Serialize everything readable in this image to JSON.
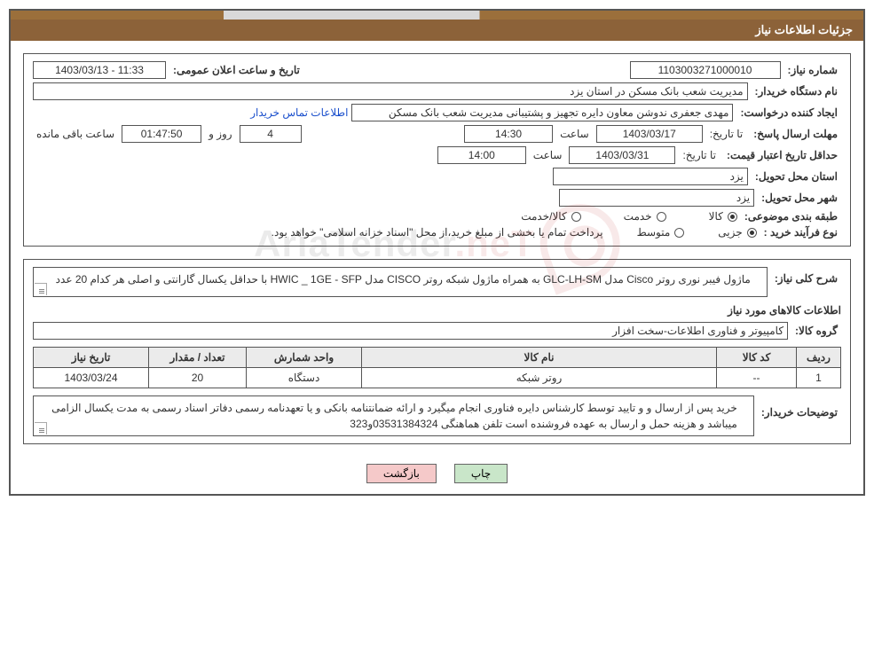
{
  "title": "جزئیات اطلاعات نیاز",
  "top": {
    "need_no_label": "شماره نیاز:",
    "need_no": "1103003271000010",
    "announce_label": "تاریخ و ساعت اعلان عمومی:",
    "announce_dt": "11:33 - 1403/03/13",
    "buyer_org_label": "نام دستگاه خریدار:",
    "buyer_org": "مدیریت شعب بانک مسکن در استان یزد",
    "creator_label": "ایجاد کننده درخواست:",
    "creator": "مهدی  جعفری ندوشن معاون دایره تجهیز و پشتیبانی مدیریت شعب بانک مسکن",
    "contact_link": "اطلاعات تماس خریدار",
    "deadline_label": "مهلت ارسال پاسخ:",
    "until_date_label": "تا تاریخ:",
    "deadline_date": "1403/03/17",
    "hour_label": "ساعت",
    "deadline_time": "14:30",
    "days_label": "روز و",
    "days_left": "4",
    "countdown": "01:47:50",
    "remain_label": "ساعت باقی مانده",
    "quote_valid_label": "حداقل تاریخ اعتبار قیمت:",
    "quote_date": "1403/03/31",
    "quote_time": "14:00",
    "province_label": "استان محل تحویل:",
    "province": "یزد",
    "city_label": "شهر محل تحویل:",
    "city": "یزد",
    "category_label": "طبقه بندی موضوعی:",
    "cat_goods": "کالا",
    "cat_service": "خدمت",
    "cat_gs": "کالا/خدمت",
    "purchase_type_label": "نوع فرآیند خرید :",
    "pt_small": "جزیی",
    "pt_medium": "متوسط",
    "payment_note": "پرداخت تمام یا بخشی از مبلغ خرید،از محل \"اسناد خزانه اسلامی\" خواهد بود."
  },
  "need": {
    "overview_label": "شرح کلی نیاز:",
    "overview_text": "ماژول فیبر نوری روتر Cisco مدل GLC-LH-SM به همراه ماژول شبکه روتر CISCO مدل HWIC _ 1GE - SFP با حداقل یکسال گارانتی و اصلی هر کدام 20 عدد",
    "items_title": "اطلاعات کالاهای مورد نیاز",
    "group_label": "گروه کالا:",
    "group": "کامپیوتر و فناوری اطلاعات-سخت افزار",
    "table": {
      "headers": {
        "row": "ردیف",
        "code": "کد کالا",
        "name": "نام کالا",
        "unit": "واحد شمارش",
        "qty": "تعداد / مقدار",
        "need_date": "تاریخ نیاز"
      },
      "rows": [
        {
          "row": "1",
          "code": "--",
          "name": "روتر شبکه",
          "unit": "دستگاه",
          "qty": "20",
          "need_date": "1403/03/24"
        }
      ]
    },
    "buyer_notes_label": "توضیحات خریدار:",
    "buyer_notes": "خرید پس از ارسال و و تایید توسط کارشناس دایره فناوری انجام میگیرد و ارائه ضمانتنامه بانکی و یا تعهدنامه رسمی دفاتر اسناد رسمی به مدت یکسال الزامی میباشد و هزینه حمل و ارسال به عهده فروشنده است تلفن هماهنگی 03531384324و323"
  },
  "buttons": {
    "print": "چاپ",
    "back": "بازگشت"
  },
  "watermark": {
    "brand": "AriaTender",
    "suffix": ".neT"
  }
}
